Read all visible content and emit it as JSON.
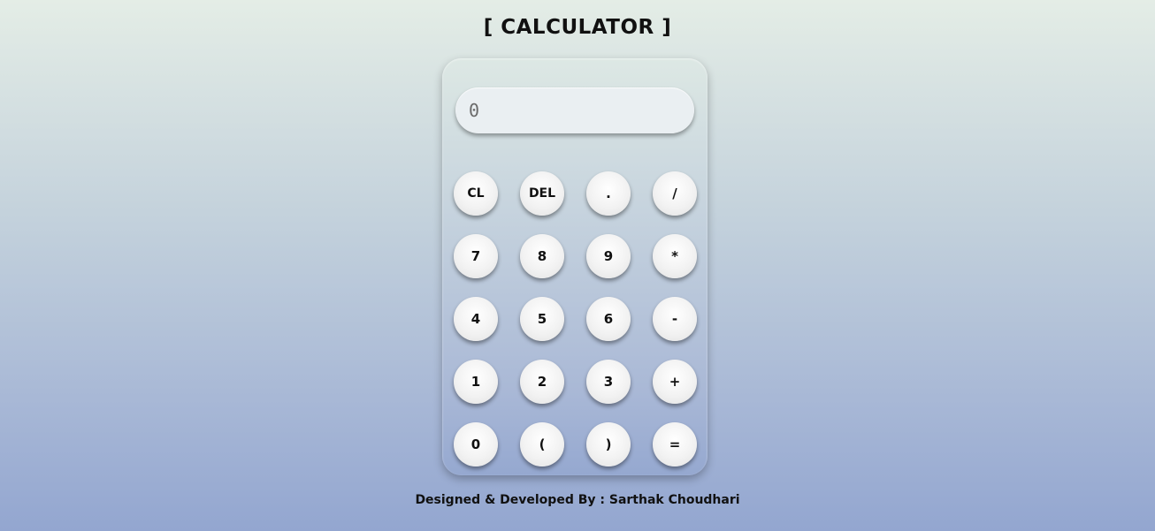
{
  "header": {
    "title": "[ CALCULATOR ]"
  },
  "display": {
    "placeholder": "0",
    "value": ""
  },
  "keys": [
    {
      "label": "CL",
      "name": "clear-button"
    },
    {
      "label": "DEL",
      "name": "delete-button"
    },
    {
      "label": ".",
      "name": "decimal-button"
    },
    {
      "label": "/",
      "name": "divide-button"
    },
    {
      "label": "7",
      "name": "digit-7-button"
    },
    {
      "label": "8",
      "name": "digit-8-button"
    },
    {
      "label": "9",
      "name": "digit-9-button"
    },
    {
      "label": "*",
      "name": "multiply-button"
    },
    {
      "label": "4",
      "name": "digit-4-button"
    },
    {
      "label": "5",
      "name": "digit-5-button"
    },
    {
      "label": "6",
      "name": "digit-6-button"
    },
    {
      "label": "-",
      "name": "subtract-button"
    },
    {
      "label": "1",
      "name": "digit-1-button"
    },
    {
      "label": "2",
      "name": "digit-2-button"
    },
    {
      "label": "3",
      "name": "digit-3-button"
    },
    {
      "label": "+",
      "name": "add-button"
    },
    {
      "label": "0",
      "name": "digit-0-button"
    },
    {
      "label": "(",
      "name": "open-paren-button"
    },
    {
      "label": ")",
      "name": "close-paren-button"
    },
    {
      "label": "=",
      "name": "equals-button"
    }
  ],
  "footer": {
    "credit": "Designed & Developed By : Sarthak Choudhari"
  },
  "colors": {
    "background_top": "#e4ede6",
    "background_bottom": "#93a6d0",
    "key_face": "#f2f2f2",
    "display_bg": "#eaeff2"
  }
}
